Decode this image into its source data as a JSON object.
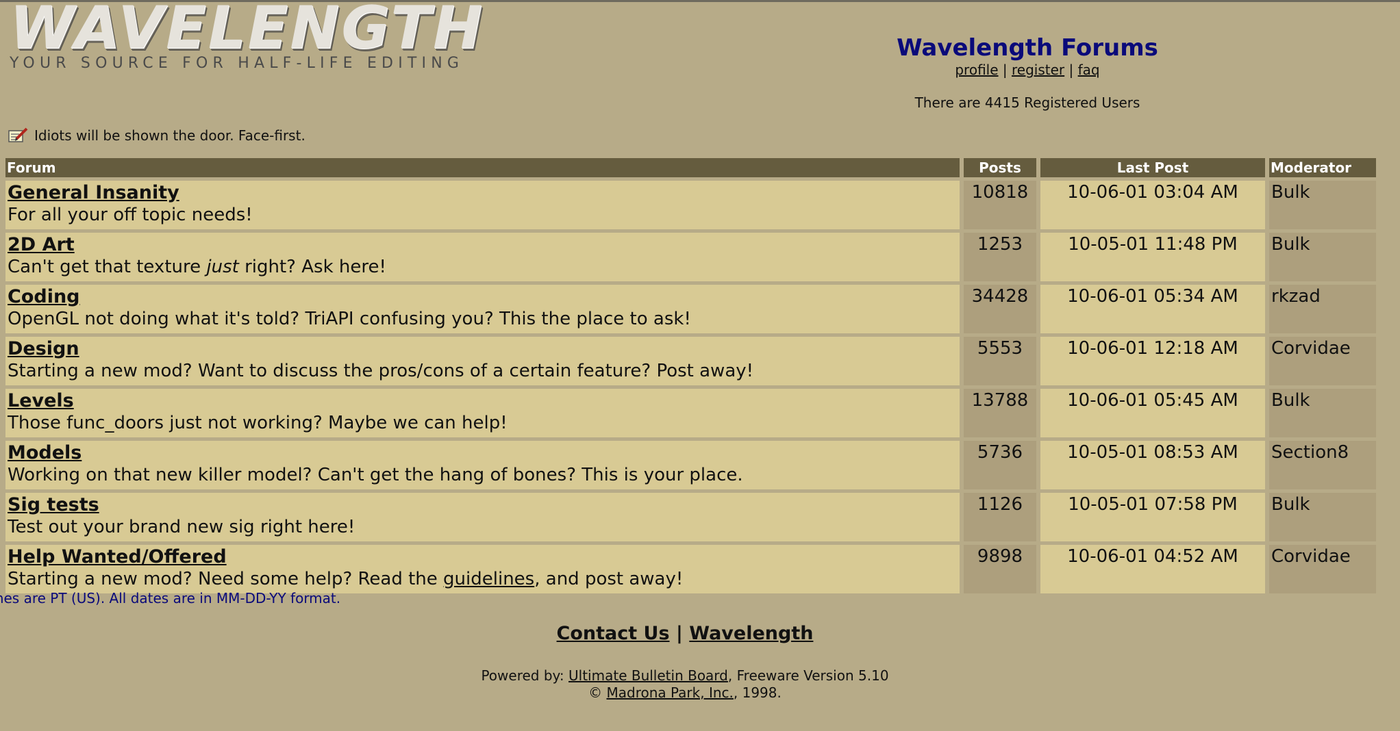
{
  "logo": {
    "word": "WAVELENGTH",
    "tagline": "YOUR SOURCE FOR HALF-LIFE EDITING"
  },
  "header": {
    "title": "Wavelength Forums",
    "links": [
      {
        "label": "profile"
      },
      {
        "label": "register"
      },
      {
        "label": "faq"
      }
    ],
    "separator": "|",
    "registered_users": "There are 4415 Registered Users"
  },
  "announcement": {
    "icon": "note-pencil-icon",
    "text": "Idiots will be shown the door. Face-first."
  },
  "table": {
    "headers": {
      "forum": "Forum",
      "posts": "Posts",
      "last_post": "Last Post",
      "moderator": "Moderator"
    },
    "rows": [
      {
        "name": "General Insanity",
        "desc": "For all your off topic needs!",
        "posts": "10818",
        "last_post": "10-06-01 03:04 AM",
        "moderator": "Bulk"
      },
      {
        "name": "2D Art",
        "desc_pre": "Can't get that texture ",
        "desc_em": "just",
        "desc_post": " right? Ask here!",
        "posts": "1253",
        "last_post": "10-05-01 11:48 PM",
        "moderator": "Bulk"
      },
      {
        "name": "Coding",
        "desc": "OpenGL not doing what it's told? TriAPI confusing you? This the place to ask!",
        "posts": "34428",
        "last_post": "10-06-01 05:34 AM",
        "moderator": "rkzad"
      },
      {
        "name": "Design",
        "desc": "Starting a new mod? Want to discuss the pros/cons of a certain feature? Post away!",
        "posts": "5553",
        "last_post": "10-06-01 12:18 AM",
        "moderator": "Corvidae"
      },
      {
        "name": "Levels",
        "desc": "Those func_doors just not working? Maybe we can help!",
        "posts": "13788",
        "last_post": "10-06-01 05:45 AM",
        "moderator": "Bulk"
      },
      {
        "name": "Models",
        "desc": "Working on that new killer model? Can't get the hang of bones? This is your place.",
        "posts": "5736",
        "last_post": "10-05-01 08:53 AM",
        "moderator": "Section8"
      },
      {
        "name": "Sig tests",
        "desc": "Test out your brand new sig right here!",
        "posts": "1126",
        "last_post": "10-05-01 07:58 PM",
        "moderator": "Bulk"
      },
      {
        "name": "Help Wanted/Offered",
        "desc_pre": "Starting a new mod? Need some help? Read the ",
        "desc_link": "guidelines",
        "desc_post": ", and post away!",
        "posts": "9898",
        "last_post": "10-06-01 04:52 AM",
        "moderator": "Corvidae"
      }
    ]
  },
  "timezone_note": "mes are PT (US). All dates are in MM-DD-YY format.",
  "footer": {
    "contact": "Contact Us",
    "separator": "|",
    "site": "Wavelength",
    "powered_pre": "Powered by: ",
    "powered_link": "Ultimate Bulletin Board",
    "powered_post": ", Freeware Version 5.10",
    "copyright_pre": "© ",
    "copyright_link": "Madrona Park, Inc.",
    "copyright_post": ", 1998."
  },
  "colors": {
    "page_bg": "#b7ab88",
    "header_bg": "#655c3e",
    "row_light": "#d8ca94",
    "row_dark": "#ad9f7d",
    "title_blue": "#0a0a7a"
  }
}
